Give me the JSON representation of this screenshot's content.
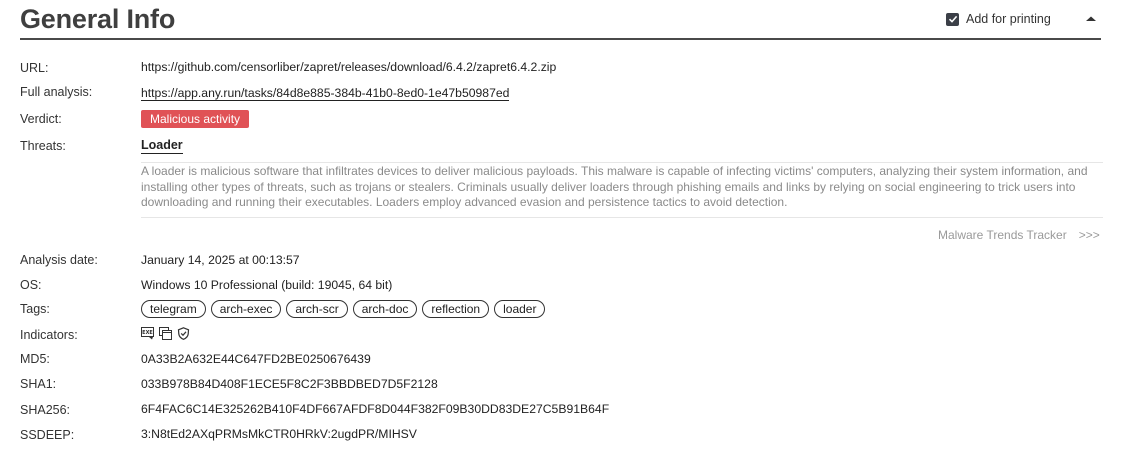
{
  "header": {
    "title": "General Info",
    "print_label": "Add for printing",
    "print_checked": true
  },
  "fields": {
    "url_label": "URL:",
    "url_value": "https://github.com/censorliber/zapret/releases/download/6.4.2/zapret6.4.2.zip",
    "full_label": "Full analysis:",
    "full_value": "https://app.any.run/tasks/84d8e885-384b-41b0-8ed0-1e47b50987ed",
    "verdict_label": "Verdict:",
    "verdict_value": "Malicious activity",
    "threats_label": "Threats:",
    "threat_name": "Loader",
    "threat_description": "A loader is malicious software that infiltrates devices to deliver malicious payloads. This malware is capable of infecting victims' computers, analyzing their system information, and installing other types of threats, such as trojans or stealers. Criminals usually deliver loaders through phishing emails and links by relying on social engineering to trick users into downloading and running their executables. Loaders employ advanced evasion and persistence tactics to avoid detection.",
    "trends_label": "Malware Trends Tracker",
    "trends_arrows": ">>>",
    "date_label": "Analysis date:",
    "date_value": "January 14, 2025 at 00:13:57",
    "os_label": "OS:",
    "os_value": "Windows 10 Professional (build: 19045, 64 bit)",
    "tags_label": "Tags:",
    "tags": [
      "telegram",
      "arch-exec",
      "arch-scr",
      "arch-doc",
      "reflection",
      "loader"
    ],
    "indicators_label": "Indicators:",
    "indicators": [
      "exe-file-icon",
      "windows-stack-icon",
      "shield-icon"
    ],
    "md5_label": "MD5:",
    "md5_value": "0A33B2A632E44C647FD2BE0250676439",
    "sha1_label": "SHA1:",
    "sha1_value": "033B978B84D408F1ECE5F8C2F3BBDBED7D5F2128",
    "sha256_label": "SHA256:",
    "sha256_value": "6F4FAC6C14E325262B410F4DF667AFDF8D044F382F09B30DD83DE27C5B91B64F",
    "ssdeep_label": "SSDEEP:",
    "ssdeep_value": "3:N8tEd2AXqPRMsMkCTR0HRkV:2ugdPR/MIHSV"
  },
  "colors": {
    "verdict_bg": "#e05256",
    "rule": "#4a4a4a",
    "muted": "#8a8a8a"
  }
}
